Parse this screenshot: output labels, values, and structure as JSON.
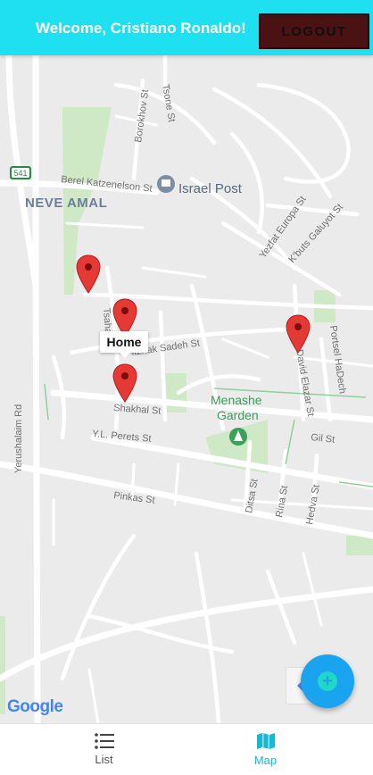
{
  "header": {
    "welcome_text": "Welcome, Cristiano Ronaldo!",
    "logout_label": "LOGOUT"
  },
  "map": {
    "area_label": "NEVE AMAL",
    "poi_label": "Israel Post",
    "garden_label_line1": "Menashe",
    "garden_label_line2": "Garden",
    "route_shield": "541",
    "streets": {
      "borokhov": "Borokhov St",
      "tsone": "Tsone St",
      "berel": "Berel Katzenelson St",
      "yezfat": "Yezfat Europa St",
      "kbuts": "K'buts Galuyot St",
      "yerushalaim": "Yerushalaim Rd",
      "tsahal": "Tsahal",
      "yitzhak": "itzhak Sadeh St",
      "shakhal": "Shakhal St",
      "david": "David Elazar St",
      "portsel": "Portsel HaDech",
      "perets": "Y.L. Perets St",
      "gil": "Gil St",
      "pinkas": "Pinkas St",
      "ditsa": "Ditsa St",
      "rina": "Rina St",
      "hedva": "Hedva St"
    },
    "home_tooltip": "Home",
    "google_logo": "Google",
    "marker_color": "#e53935"
  },
  "fab": {
    "icon": "plus-icon"
  },
  "nav": {
    "list_label": "List",
    "map_label": "Map",
    "active_color": "#19b8d2"
  }
}
